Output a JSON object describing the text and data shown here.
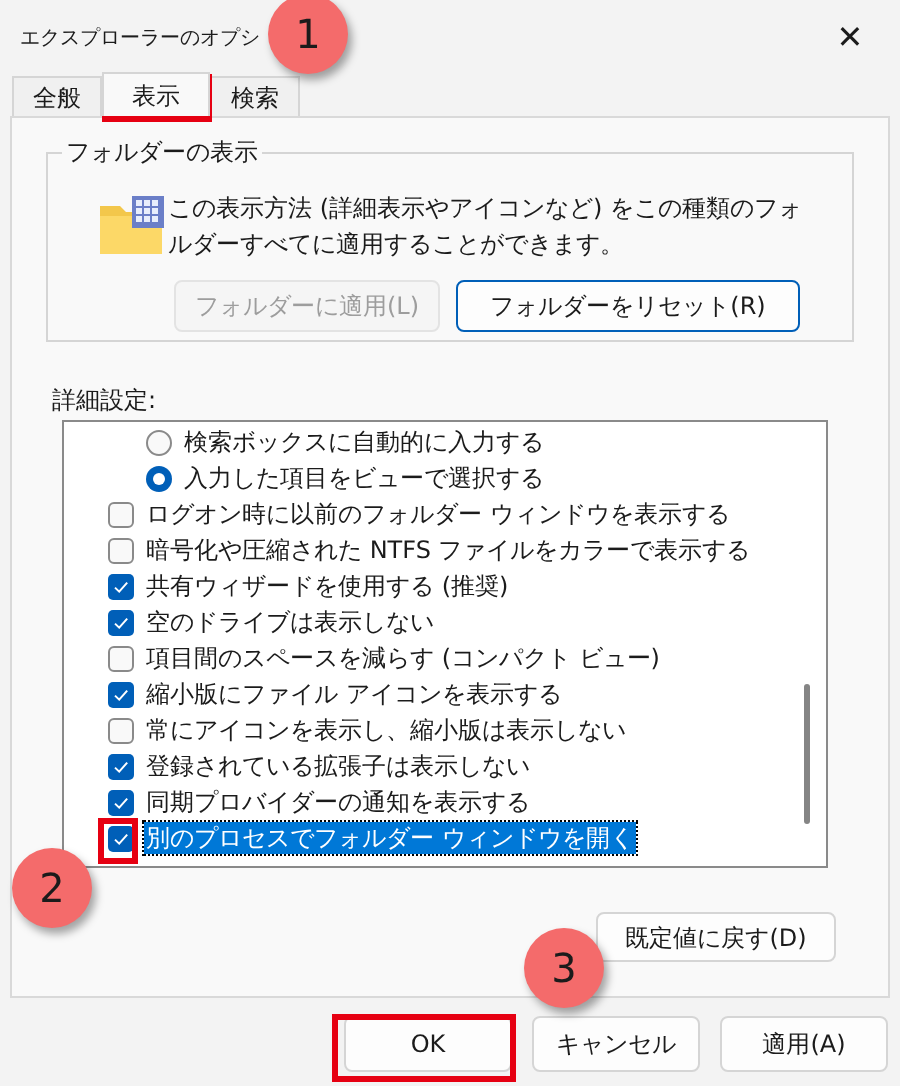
{
  "window": {
    "title": "エクスプローラーのオプシ",
    "close": "✕"
  },
  "tabs": [
    {
      "label": "全般",
      "selected": false
    },
    {
      "label": "表示",
      "selected": true
    },
    {
      "label": "検索",
      "selected": false
    }
  ],
  "folder_views": {
    "title": "フォルダーの表示",
    "description": "この表示方法 (詳細表示やアイコンなど) をこの種類のフォルダーすべてに適用することができます。",
    "buttons": [
      {
        "label": "フォルダーに適用(L)",
        "disabled": true
      },
      {
        "label": "フォルダーをリセット(R)",
        "disabled": false
      }
    ]
  },
  "advanced": {
    "label": "詳細設定:",
    "items": [
      {
        "kind": "radio",
        "label": "検索ボックスに自動的に入力する",
        "checked": false,
        "selected": false
      },
      {
        "kind": "radio",
        "label": "入力した項目をビューで選択する",
        "checked": true,
        "selected": false
      },
      {
        "kind": "checkbox",
        "label": "ログオン時に以前のフォルダー ウィンドウを表示する",
        "checked": false,
        "selected": false
      },
      {
        "kind": "checkbox",
        "label": "暗号化や圧縮された NTFS ファイルをカラーで表示する",
        "checked": false,
        "selected": false
      },
      {
        "kind": "checkbox",
        "label": "共有ウィザードを使用する (推奨)",
        "checked": true,
        "selected": false
      },
      {
        "kind": "checkbox",
        "label": "空のドライブは表示しない",
        "checked": true,
        "selected": false
      },
      {
        "kind": "checkbox",
        "label": "項目間のスペースを減らす (コンパクト ビュー)",
        "checked": false,
        "selected": false
      },
      {
        "kind": "checkbox",
        "label": "縮小版にファイル アイコンを表示する",
        "checked": true,
        "selected": false
      },
      {
        "kind": "checkbox",
        "label": "常にアイコンを表示し、縮小版は表示しない",
        "checked": false,
        "selected": false
      },
      {
        "kind": "checkbox",
        "label": "登録されている拡張子は表示しない",
        "checked": true,
        "selected": false
      },
      {
        "kind": "checkbox",
        "label": "同期プロバイダーの通知を表示する",
        "checked": true,
        "selected": false
      },
      {
        "kind": "checkbox",
        "label": "別のプロセスでフォルダー ウィンドウを開く",
        "checked": true,
        "selected": true
      }
    ],
    "restore_button": "既定値に戻す(D)"
  },
  "buttons": [
    {
      "label": "OK"
    },
    {
      "label": "キャンセル"
    },
    {
      "label": "適用(A)"
    }
  ],
  "annotations": [
    {
      "label": "1"
    },
    {
      "label": "2"
    },
    {
      "label": "3"
    }
  ]
}
